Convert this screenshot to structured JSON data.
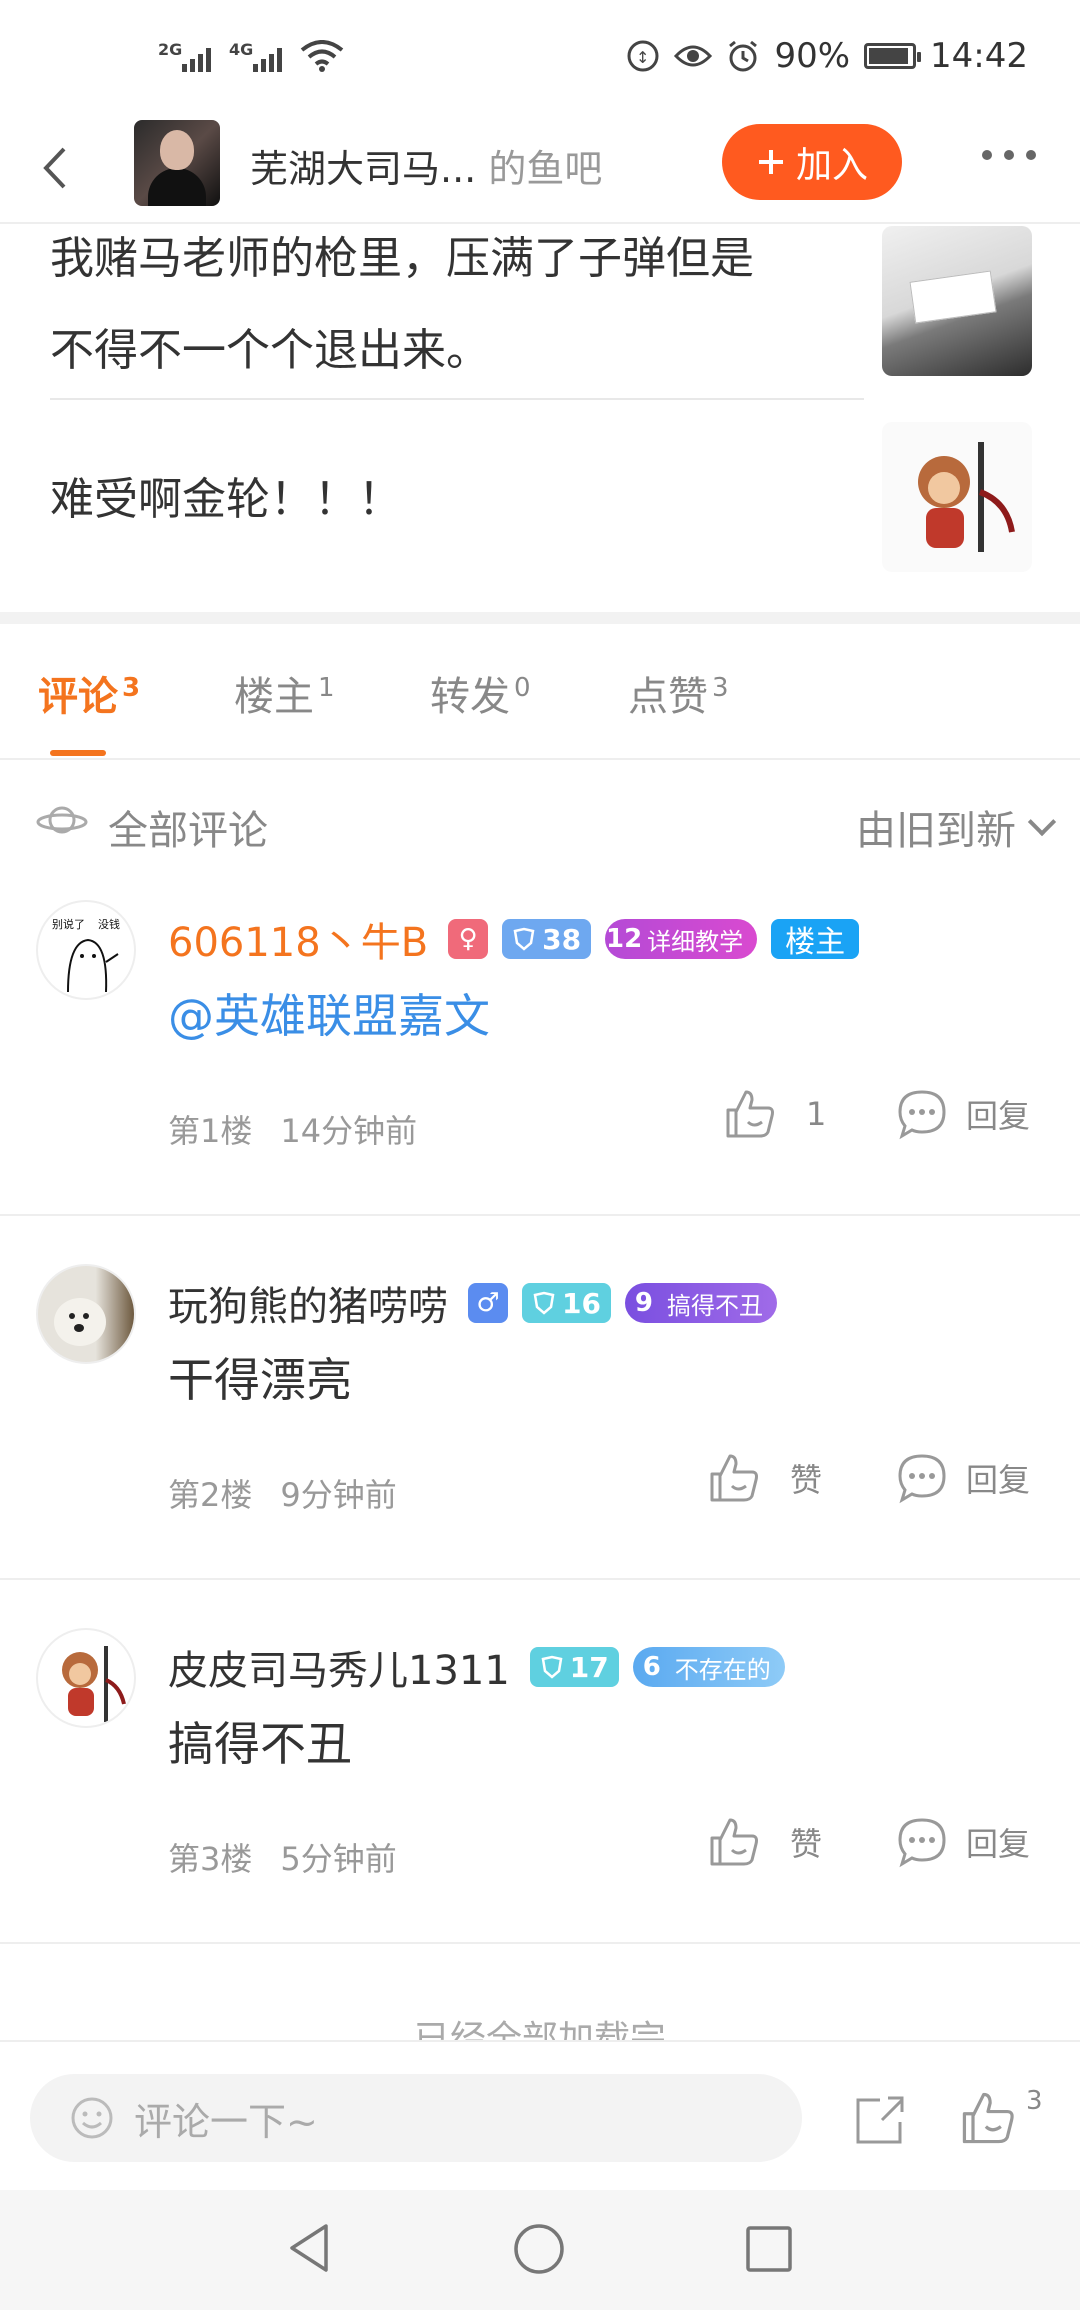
{
  "status_bar": {
    "net1": "2G",
    "net2": "4G",
    "battery": "90%",
    "time": "14:42",
    "battery_level": 0.9
  },
  "header": {
    "back_icon": "back-arrow-icon",
    "forum_name": "芜湖大司马...",
    "forum_suffix": "的鱼吧",
    "join_label": "加入",
    "more_icon": "more-icon"
  },
  "post": {
    "paragraph1_line1": "我赌马老师的枪里，压满了子弹但是",
    "paragraph1_line2": "不得不一个个退出来。",
    "paragraph2": "难受啊金轮！！！"
  },
  "tabs": [
    {
      "label": "评论",
      "count": "3"
    },
    {
      "label": "楼主",
      "count": "1"
    },
    {
      "label": "转发",
      "count": "0"
    },
    {
      "label": "点赞",
      "count": "3"
    }
  ],
  "sort": {
    "label": "全部评论",
    "order": "由旧到新"
  },
  "comments": [
    {
      "name": "606118丶牛B",
      "level": "38",
      "rank_num": "12",
      "rank_title": "详细教学",
      "host_badge": "楼主",
      "text": "@英雄联盟嘉文",
      "floor": "第1楼",
      "time": "14分钟前",
      "like": "1",
      "reply": "回复"
    },
    {
      "name": "玩狗熊的猪唠唠",
      "level": "16",
      "rank_num": "9",
      "rank_title": "搞得不丑",
      "text": "干得漂亮",
      "floor": "第2楼",
      "time": "9分钟前",
      "like": "赞",
      "reply": "回复"
    },
    {
      "name": "皮皮司马秀儿1311",
      "level": "17",
      "rank_num": "6",
      "rank_title": "不存在的",
      "text": "搞得不丑",
      "floor": "第3楼",
      "time": "5分钟前",
      "like": "赞",
      "reply": "回复"
    }
  ],
  "avatar1_text": {
    "left": "别说了",
    "right": "没钱"
  },
  "footer_note": "— 已经全部加载完 —",
  "bottom_bar": {
    "placeholder": "评论一下~",
    "like_count": "3"
  },
  "colors": {
    "accent": "#f4741e",
    "join": "#ff5a1f",
    "link": "#3a8ee6",
    "host": "#1aa3f5"
  }
}
